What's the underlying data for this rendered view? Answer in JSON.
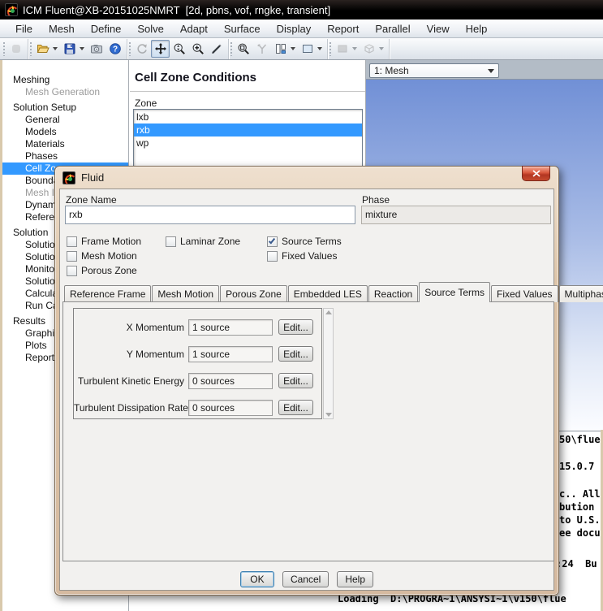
{
  "window": {
    "title": "ICM Fluent@XB-20151025NMRT  [2d, pbns, vof, rngke, transient]"
  },
  "menu": {
    "items": [
      "File",
      "Mesh",
      "Define",
      "Solve",
      "Adapt",
      "Surface",
      "Display",
      "Report",
      "Parallel",
      "View",
      "Help"
    ]
  },
  "toolbar": {
    "icons": [
      "blank",
      "open-folder",
      "save",
      "snapshot",
      "help",
      "rotate",
      "pan",
      "zoom-scale",
      "zoom-in",
      "probe",
      "zoom-box",
      "profile",
      "layout-columns",
      "viewport-rect",
      "render-mode",
      "view-cube"
    ]
  },
  "sidebar": {
    "items": [
      {
        "label": "Meshing",
        "type": "header"
      },
      {
        "label": "Mesh Generation",
        "type": "disabled"
      },
      {
        "label": "Solution Setup",
        "type": "header"
      },
      {
        "label": "General",
        "type": "item"
      },
      {
        "label": "Models",
        "type": "item"
      },
      {
        "label": "Materials",
        "type": "item"
      },
      {
        "label": "Phases",
        "type": "item"
      },
      {
        "label": "Cell Zon",
        "type": "selected",
        "selected": true
      },
      {
        "label": "Bounda",
        "type": "item"
      },
      {
        "label": "Mesh In",
        "type": "disabled"
      },
      {
        "label": "Dynami",
        "type": "item"
      },
      {
        "label": "Refere",
        "type": "item"
      },
      {
        "label": "Solution",
        "type": "header"
      },
      {
        "label": "Solution",
        "type": "item"
      },
      {
        "label": "Solution",
        "type": "item"
      },
      {
        "label": "Monitor",
        "type": "item"
      },
      {
        "label": "Solution",
        "type": "item"
      },
      {
        "label": "Calcula",
        "type": "item"
      },
      {
        "label": "Run Ca",
        "type": "item"
      },
      {
        "label": "Results",
        "type": "header"
      },
      {
        "label": "Graphic",
        "type": "item"
      },
      {
        "label": "Plots",
        "type": "item"
      },
      {
        "label": "Reports",
        "type": "item"
      }
    ]
  },
  "task_page": {
    "title": "Cell Zone Conditions",
    "zone_label": "Zone",
    "zones": [
      "lxb",
      "rxb",
      "wp"
    ],
    "selected_zone": "rxb"
  },
  "graphics": {
    "view_selector": "1: Mesh"
  },
  "console": {
    "fragments": [
      "50\\flue",
      "15.0.7",
      "c.. All",
      "bution",
      "to U.S.",
      "ee docu",
      ":24  Bu"
    ],
    "loading_line": "Loading  D:\\PROGRA~1\\ANSYSI~1\\v150\\flue"
  },
  "dialog": {
    "title": "Fluid",
    "zone_name": {
      "label": "Zone Name",
      "value": "rxb"
    },
    "phase": {
      "label": "Phase",
      "value": "mixture"
    },
    "checkboxes": [
      {
        "label": "Frame Motion",
        "checked": false
      },
      {
        "label": "Laminar Zone",
        "checked": false
      },
      {
        "label": "Source Terms",
        "checked": true
      },
      {
        "label": "Mesh Motion",
        "checked": false
      },
      {
        "label": "Fixed Values",
        "checked": false
      },
      {
        "label": "Porous Zone",
        "checked": false
      }
    ],
    "tabs": [
      {
        "label": "Reference Frame"
      },
      {
        "label": "Mesh Motion"
      },
      {
        "label": "Porous Zone"
      },
      {
        "label": "Embedded LES"
      },
      {
        "label": "Reaction"
      },
      {
        "label": "Source Terms",
        "active": true
      },
      {
        "label": "Fixed Values"
      },
      {
        "label": "Multiphase"
      }
    ],
    "source_terms": {
      "rows": [
        {
          "label": "X Momentum",
          "value": "1 source",
          "button": "Edit..."
        },
        {
          "label": "Y Momentum",
          "value": "1 source",
          "button": "Edit..."
        },
        {
          "label": "Turbulent Kinetic Energy",
          "value": "0 sources",
          "button": "Edit..."
        },
        {
          "label": "Turbulent Dissipation Rate",
          "value": "0 sources",
          "button": "Edit..."
        }
      ]
    },
    "buttons": [
      {
        "label": "OK"
      },
      {
        "label": "Cancel"
      },
      {
        "label": "Help"
      }
    ]
  },
  "colors": {
    "selection": "#3399ff",
    "graphics_top": "#7190d6",
    "dialog_border": "#d5baa0",
    "titlebar": "#000000",
    "close_red": "#c64a2e"
  }
}
